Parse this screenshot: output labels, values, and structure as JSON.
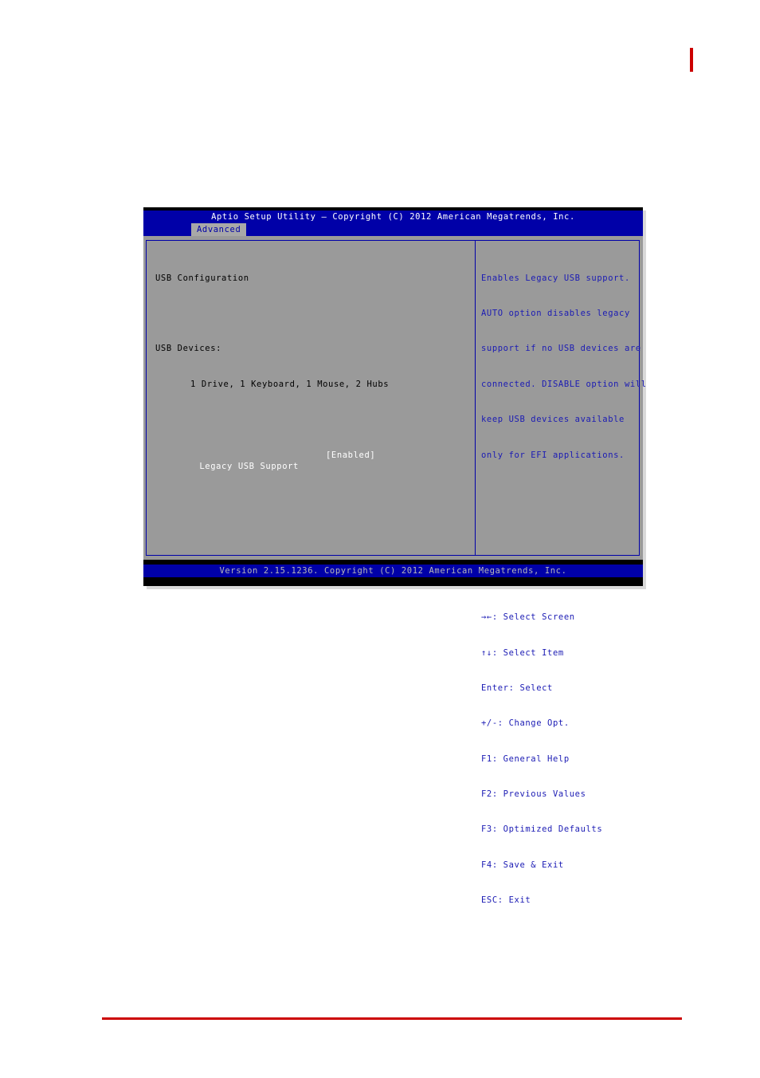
{
  "bios": {
    "title": "Aptio Setup Utility – Copyright (C) 2012 American Megatrends, Inc.",
    "tab_label": "Advanced",
    "footer": "Version 2.15.1236. Copyright (C) 2012 American Megatrends, Inc.",
    "left_panel": {
      "section_title": "USB Configuration",
      "devices_label": "USB Devices:",
      "devices_value": "1 Drive, 1 Keyboard, 1 Mouse, 2 Hubs",
      "setting_label": "Legacy USB Support",
      "setting_value": "[Enabled]"
    },
    "help": {
      "lines": [
        "Enables Legacy USB support.",
        "AUTO option disables legacy",
        "support if no USB devices are",
        "connected. DISABLE option will",
        "keep USB devices available",
        "only for EFI applications."
      ]
    },
    "keys": [
      "→←: Select Screen",
      "↑↓: Select Item",
      "Enter: Select",
      "+/-: Change Opt.",
      "F1: General Help",
      "F2: Previous Values",
      "F3: Optimized Defaults",
      "F4: Save & Exit",
      "ESC: Exit"
    ]
  },
  "colors": {
    "bios_blue": "#0000a8",
    "bios_gray": "#9a9a9a",
    "help_text": "#1b1bb4",
    "accent_red": "#cc0000"
  }
}
